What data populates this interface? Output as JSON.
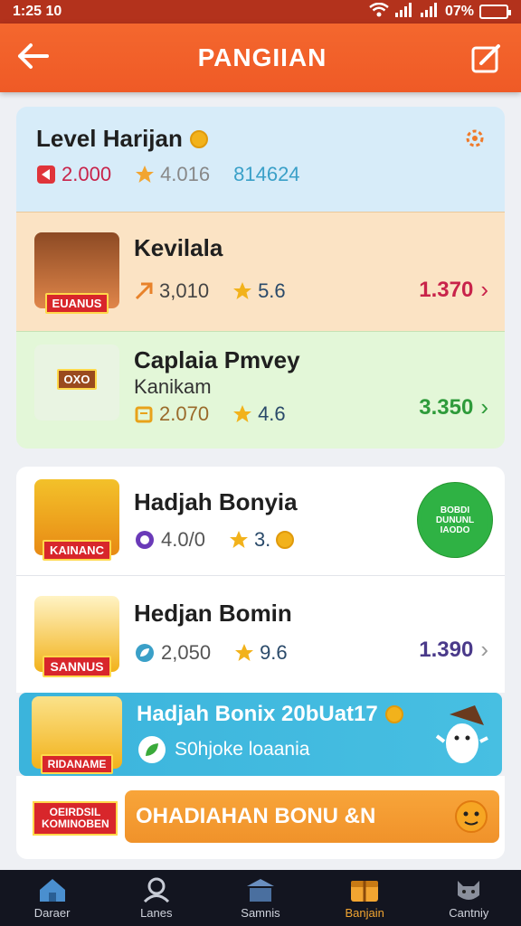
{
  "status": {
    "time": "1:25 10",
    "battery": "07%"
  },
  "header": {
    "title": "PANGIIAN"
  },
  "level_card": {
    "title": "Level Harijan",
    "stat1": "2.000",
    "stat2": "4.016",
    "stat3": "814624"
  },
  "items": [
    {
      "name": "Kevilala",
      "ribbon": "EUANUS",
      "stat1": "3,010",
      "stat2": "5.6",
      "value": "1.370"
    },
    {
      "name": "Caplaia Pmvey",
      "sub": "Kanikam",
      "ribbon": "OXO",
      "stat1": "2.070",
      "stat2": "4.6",
      "value": "3.350"
    },
    {
      "name": "Hadjah Bonyia",
      "ribbon": "KAINANC",
      "stat1": "4.0/0",
      "stat2": "3.",
      "badge": "BOBDI DUNUNL IAODO"
    },
    {
      "name": "Hedjan Bomin",
      "ribbon": "SANNUS",
      "stat1": "2,050",
      "stat2": "9.6",
      "value": "1.390"
    }
  ],
  "promo": {
    "title": "Hadjah Bonix 20bUat17",
    "sub": "S0hjoke loaania",
    "ribbon": "RIDANAME"
  },
  "footer_card": {
    "ribbon": "OEIRDSIL KOMINOBEN",
    "button": "OHADIAHAN BONU &N"
  },
  "nav": [
    {
      "label": "Daraer",
      "icon": "home-icon"
    },
    {
      "label": "Lanes",
      "icon": "user-icon"
    },
    {
      "label": "Samnis",
      "icon": "shop-icon"
    },
    {
      "label": "Banjain",
      "icon": "gift-icon"
    },
    {
      "label": "Cantniy",
      "icon": "cat-icon"
    }
  ],
  "colors": {
    "accent": "#ef5a26",
    "positive": "#2e9b3a",
    "negative": "#c8234a",
    "nav_active": "#f2a531"
  }
}
